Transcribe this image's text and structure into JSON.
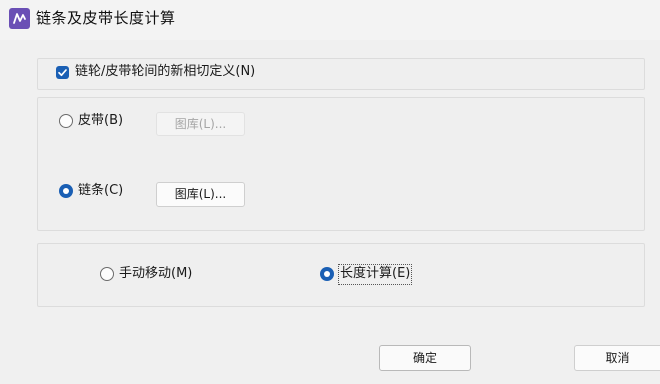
{
  "window": {
    "title": "链条及皮带长度计算"
  },
  "options": {
    "new_tangent_label": "链轮/皮带轮间的新相切定义(N)",
    "new_tangent_checked": true
  },
  "type_group": {
    "belt_label": "皮带(B)",
    "belt_selected": false,
    "belt_library_button": "图库(L)...",
    "belt_library_enabled": false,
    "chain_label": "链条(C)",
    "chain_selected": true,
    "chain_library_button": "图库(L)...",
    "chain_library_enabled": true
  },
  "mode_group": {
    "manual_move_label": "手动移动(M)",
    "manual_move_selected": false,
    "length_calc_label": "长度计算(E)",
    "length_calc_selected": true
  },
  "footer": {
    "ok_button": "确定",
    "cancel_button": "取消"
  }
}
